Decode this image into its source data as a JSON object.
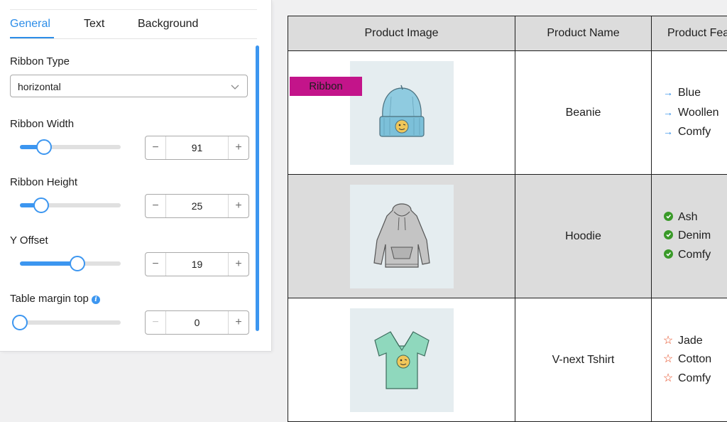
{
  "tabs": [
    {
      "label": "General",
      "active": true
    },
    {
      "label": "Text",
      "active": false
    },
    {
      "label": "Background",
      "active": false
    }
  ],
  "settings": {
    "ribbon_type": {
      "label": "Ribbon Type",
      "value": "horizontal"
    },
    "ribbon_width": {
      "label": "Ribbon Width",
      "value": "91",
      "slider_level": 0.24
    },
    "ribbon_height": {
      "label": "Ribbon Height",
      "value": "25",
      "slider_level": 0.21
    },
    "y_offset": {
      "label": "Y Offset",
      "value": "19",
      "slider_level": 0.57
    },
    "table_margin_top": {
      "label": "Table margin top",
      "value": "0",
      "slider_level": 0.0,
      "info_icon": "i"
    }
  },
  "stepper": {
    "minus": "−",
    "plus": "+"
  },
  "table": {
    "headers": [
      "Product Image",
      "Product Name",
      "Product Features"
    ],
    "ribbon_label": "Ribbon",
    "rows": [
      {
        "name": "Beanie",
        "image": "beanie-image",
        "feature_icon": "arrow-right-icon",
        "features": [
          "Blue",
          "Woollen",
          "Comfy"
        ]
      },
      {
        "name": "Hoodie",
        "image": "hoodie-image",
        "feature_icon": "green-check-circle-icon",
        "features": [
          "Ash",
          "Denim",
          "Comfy"
        ]
      },
      {
        "name": "V-next Tshirt",
        "image": "tshirt-image",
        "feature_icon": "star-outline-icon",
        "features": [
          "Jade",
          "Cotton",
          "Comfy"
        ]
      }
    ]
  },
  "colors": {
    "accent": "#2c8de8",
    "ribbon": "#c3148a",
    "header_bg": "#dcdcdc",
    "check": "#3a9a29",
    "star": "#e5481e"
  }
}
